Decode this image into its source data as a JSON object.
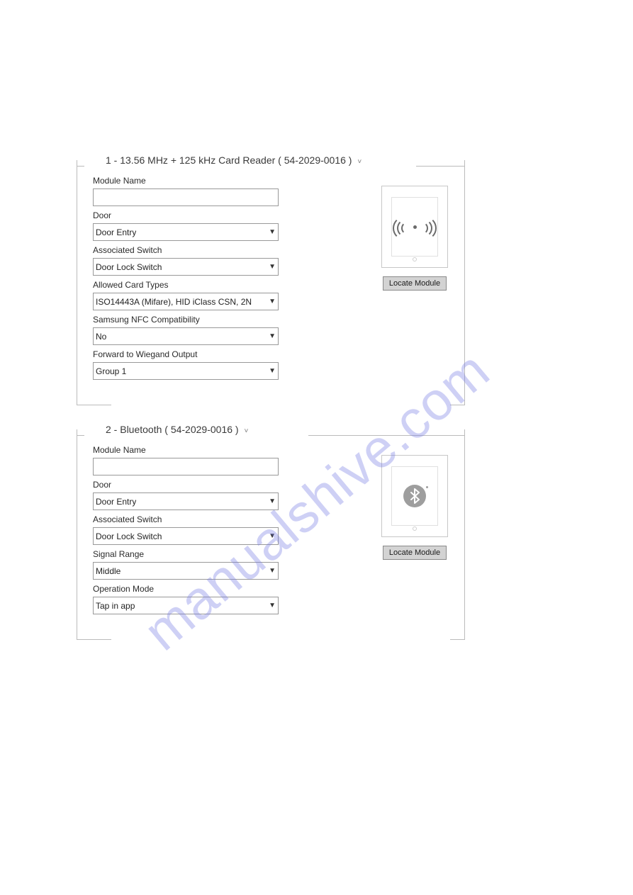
{
  "watermark": "manualshive.com",
  "common": {
    "locate_button_label": "Locate Module"
  },
  "modules": [
    {
      "title": "1 - 13.56 MHz + 125 kHz Card Reader ( 54-2029-0016 )",
      "icon": "nfc-icon",
      "fields": {
        "module_name": {
          "label": "Module Name",
          "value": ""
        },
        "door": {
          "label": "Door",
          "value": "Door Entry"
        },
        "associated_switch": {
          "label": "Associated Switch",
          "value": "Door Lock Switch"
        },
        "allowed_card_types": {
          "label": "Allowed Card Types",
          "value": "ISO14443A (Mifare), HID iClass CSN, 2N"
        },
        "samsung_nfc": {
          "label": "Samsung NFC Compatibility",
          "value": "No"
        },
        "forward_wiegand": {
          "label": "Forward to Wiegand Output",
          "value": "Group 1"
        }
      }
    },
    {
      "title": "2 - Bluetooth ( 54-2029-0016 )",
      "icon": "bluetooth-icon",
      "fields": {
        "module_name": {
          "label": "Module Name",
          "value": ""
        },
        "door": {
          "label": "Door",
          "value": "Door Entry"
        },
        "associated_switch": {
          "label": "Associated Switch",
          "value": "Door Lock Switch"
        },
        "signal_range": {
          "label": "Signal Range",
          "value": "Middle"
        },
        "operation_mode": {
          "label": "Operation Mode",
          "value": "Tap in app"
        }
      }
    }
  ]
}
